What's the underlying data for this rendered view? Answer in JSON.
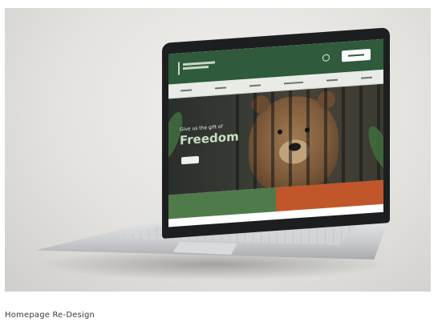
{
  "hero": {
    "kicker": "Give us the gift of",
    "title": "Freedom"
  },
  "caption": "Homepage Re-Design"
}
